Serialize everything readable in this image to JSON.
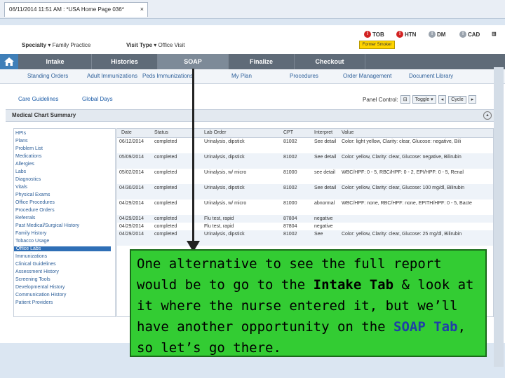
{
  "window_tab": {
    "title": "06/11/2014 11:51 AM : *USA Home Page 036*",
    "close": "×"
  },
  "filters": {
    "specialty_label": "Specialty",
    "specialty_value": "Family Practice",
    "visit_label": "Visit Type",
    "visit_value": "Office Visit"
  },
  "alerts": [
    {
      "label": "TOB",
      "color": "#d22222"
    },
    {
      "label": "HTN",
      "color": "#d22222"
    },
    {
      "label": "DM",
      "color": "#9aa3ad"
    },
    {
      "label": "CAD",
      "color": "#9aa3ad"
    }
  ],
  "former_smoker": "Former Smoker",
  "nav": {
    "items": [
      "Intake",
      "Histories",
      "SOAP",
      "Finalize",
      "Checkout"
    ]
  },
  "subnav": {
    "items": [
      "Standing Orders",
      "Adult Immunizations",
      "Peds Immunizations",
      "My Plan",
      "Procedures",
      "Order Management",
      "Document Library"
    ]
  },
  "toolbar": {
    "care_guidelines": "Care Guidelines",
    "global_days": "Global Days",
    "panel_control": "Panel Control:",
    "toggle": "Toggle",
    "cycle": "Cycle"
  },
  "summary_title": "Medical Chart Summary",
  "sidebar": {
    "items": [
      "HPIs",
      "Plans",
      "Problem List",
      "Medications",
      "Allergies",
      "Labs",
      "Diagnostics",
      "Vitals",
      "Physical Exams",
      "Office Procedures",
      "Procedure Orders",
      "Referrals",
      "Past Medical/Surgical History",
      "Family History",
      "Tobacco Usage",
      "Office Labs",
      "Immunizations",
      "Clinical Guidelines",
      "Assessment History",
      "Screening Tools",
      "Developmental History",
      "Communication History",
      "Patient Providers"
    ],
    "selected": "Office Labs"
  },
  "lab_table": {
    "columns": [
      "Date",
      "Status",
      "Lab Order",
      "CPT",
      "Interpret",
      "Value"
    ],
    "rows": [
      {
        "date": "06/12/2014",
        "status": "completed",
        "order": "Urinalysis, dipstick",
        "cpt": "81002",
        "interp": "See detail",
        "value": "Color: light yellow, Clarity: clear, Glucose: negative, Bili"
      },
      {
        "date": "05/09/2014",
        "status": "completed",
        "order": "Urinalysis, dipstick",
        "cpt": "81002",
        "interp": "See detail",
        "value": "Color: yellow, Clarity: clear, Glucose: negative, Bilirubin"
      },
      {
        "date": "05/02/2014",
        "status": "completed",
        "order": "Urinalysis, w/ micro",
        "cpt": "81000",
        "interp": "see detail",
        "value": "WBC/HPF: 0 - 5, RBC/HPF: 0 - 2, EPI/HPF: 0 - 5, Renal"
      },
      {
        "date": "04/30/2014",
        "status": "completed",
        "order": "Urinalysis, dipstick",
        "cpt": "81002",
        "interp": "See detail",
        "value": "Color: yellow, Clarity: clear, Glucose: 100 mg/dl, Bilirubin"
      },
      {
        "date": "04/29/2014",
        "status": "completed",
        "order": "Urinalysis, w/ micro",
        "cpt": "81000",
        "interp": "abnormal",
        "value": "WBC/HPF: none, RBC/HPF: none, EPITH/HPF: 0 - 5, Bacte"
      },
      {
        "date": "04/29/2014",
        "status": "completed",
        "order": "Flu test, rapid",
        "cpt": "87804",
        "interp": "negative",
        "value": ""
      },
      {
        "date": "04/29/2014",
        "status": "completed",
        "order": "Flu test, rapid",
        "cpt": "87804",
        "interp": "negative",
        "value": ""
      },
      {
        "date": "04/29/2014",
        "status": "completed",
        "order": "Urinalysis, dipstick",
        "cpt": "81002",
        "interp": "See",
        "value": "Color: yellow, Clarity: clear, Glucose: 25 mg/dl, Bilirubin"
      }
    ]
  },
  "note": {
    "part1": "One alternative to see the full report would be to go to the ",
    "intake_tab": "Intake Tab",
    "part2": " & look at it where the nurse entered it, but we’ll have another opportunity on the ",
    "soap_tab": "SOAP Tab",
    "part3": ", so let’s go there."
  }
}
